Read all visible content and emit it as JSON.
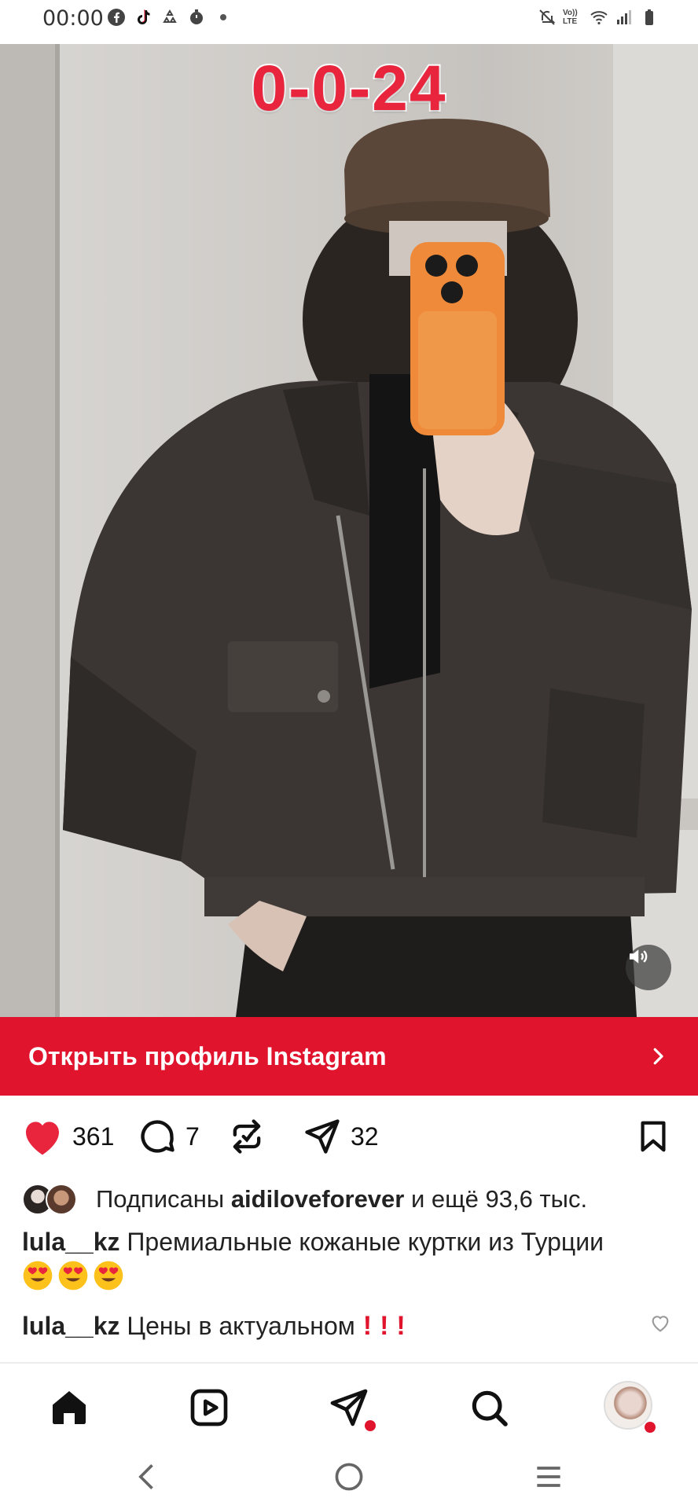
{
  "status_bar": {
    "time": "00:00",
    "left_icons": [
      "facebook-icon",
      "tiktok-icon",
      "recycle-icon",
      "timer-icon",
      "dot-icon"
    ],
    "right_icons": [
      "mute-icon",
      "volte-icon",
      "wifi-icon",
      "signal-icon",
      "battery-icon"
    ],
    "volte_text": "Vo)) LTE"
  },
  "post": {
    "overlay_code": "0-0-24",
    "cta_label": "Открыть профиль Instagram",
    "likes": "361",
    "comments": "7",
    "shares": "32",
    "liked_by_prefix": "Подписаны",
    "liked_by_user": "aidiloveforever",
    "liked_by_suffix": "и ещё 93,6 тыс.",
    "caption_user": "lula__kz",
    "caption_text": "Премиальные кожаные куртки из Турции",
    "comment_user": "lula__kz",
    "comment_text": "Цены в актуальном"
  },
  "colors": {
    "accent_red": "#e0142d",
    "like_red": "#e8253d"
  },
  "bottom_nav": [
    "home-icon",
    "reels-icon",
    "direct-icon",
    "search-icon",
    "profile-avatar"
  ],
  "system_nav": [
    "back-icon",
    "home-circle-icon",
    "recents-icon"
  ]
}
